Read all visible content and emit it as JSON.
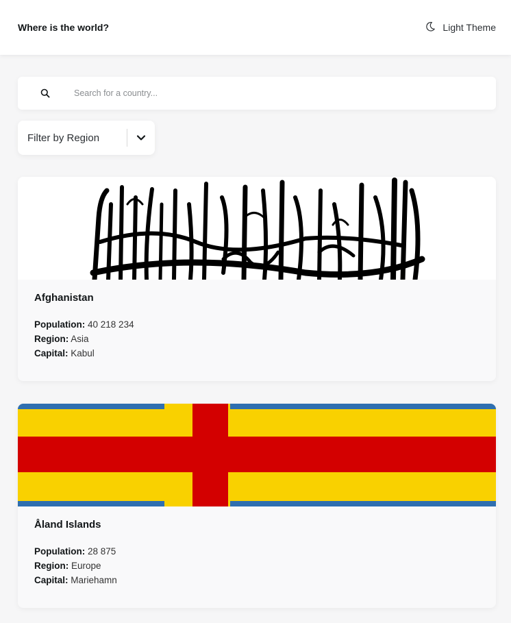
{
  "header": {
    "title": "Where is the world?",
    "theme_label": "Light Theme"
  },
  "search": {
    "placeholder": "Search for a country..."
  },
  "filter": {
    "label": "Filter by Region"
  },
  "info_labels": {
    "population": "Population:",
    "region": "Region:",
    "capital": "Capital:"
  },
  "countries": [
    {
      "name": "Afghanistan",
      "population": "40 218 234",
      "region": "Asia",
      "capital": "Kabul"
    },
    {
      "name": "Åland Islands",
      "population": "28 875",
      "region": "Europe",
      "capital": "Mariehamn"
    }
  ],
  "colors": {
    "background": "#f6f6f7",
    "card": "#f9f9fa",
    "aland_blue": "#2f6fb0",
    "aland_yellow": "#f9d100",
    "aland_red": "#d30000"
  }
}
